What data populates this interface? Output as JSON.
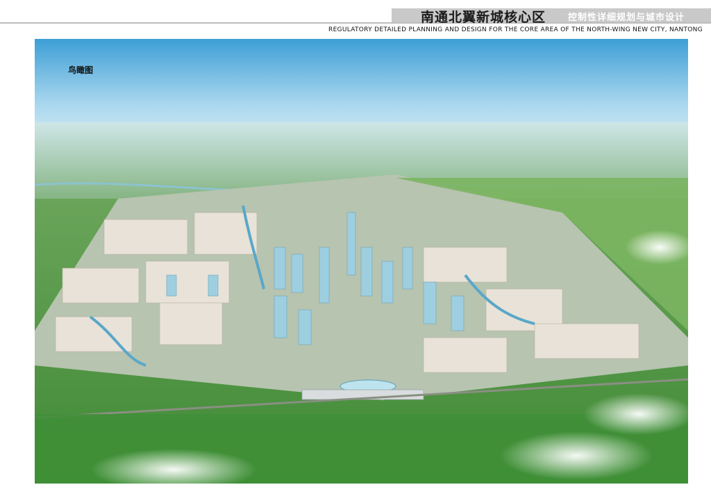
{
  "header": {
    "title_cn": "南通北翼新城核心区",
    "subtitle_cn": "控制性详细规划与城市设计",
    "title_en": "Regulatory detailed planning and design for the core area of the north-wing new city, Nantong"
  },
  "image": {
    "view_label": "鸟瞰图"
  },
  "colors": {
    "header_band": "#c9c9c9",
    "sky": "#bfe2f2",
    "green": "#4f9a3e",
    "water": "#5aa7c8"
  }
}
